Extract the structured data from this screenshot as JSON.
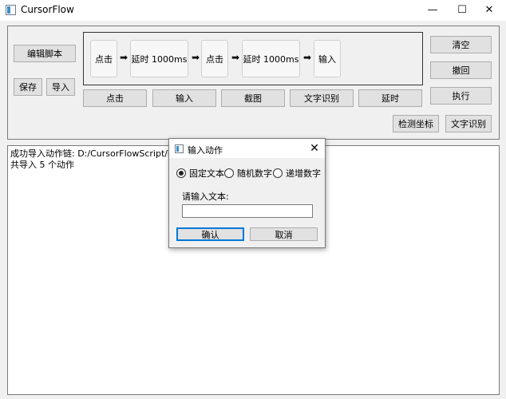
{
  "window": {
    "title": "CursorFlow",
    "minimize": "—",
    "maximize": "☐",
    "close": "✕"
  },
  "left_buttons": {
    "edit_script": "编辑脚本",
    "save": "保存",
    "import": "导入"
  },
  "flow": {
    "steps": [
      "点击",
      "延时 1000ms",
      "点击",
      "延时 1000ms",
      "输入"
    ],
    "arrow": "➡"
  },
  "action_buttons": [
    "点击",
    "输入",
    "截图",
    "文字识别",
    "延时"
  ],
  "right_buttons": {
    "clear": "清空",
    "undo": "撤回",
    "run": "执行",
    "detect_coords": "检测坐标",
    "ocr": "文字识别"
  },
  "log": [
    "成功导入动作链: D:/CursorFlowScript/输入尝试.json",
    "共导入 5 个动作"
  ],
  "dialog": {
    "title": "输入动作",
    "close": "✕",
    "options": [
      "固定文本",
      "随机数字",
      "递增数字"
    ],
    "selected_option": "固定文本",
    "prompt": "请输入文本:",
    "input_value": "",
    "confirm": "确认",
    "cancel": "取消"
  }
}
